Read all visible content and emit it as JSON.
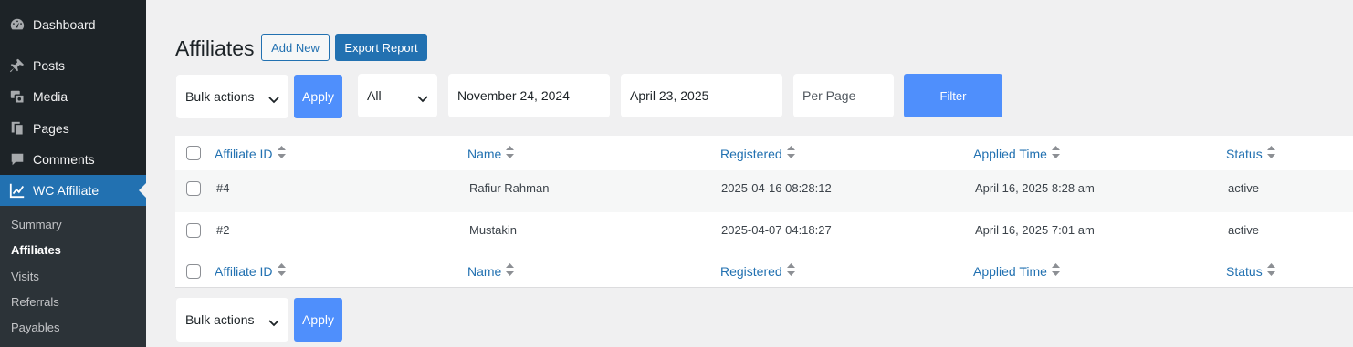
{
  "sidebar": {
    "menu": [
      {
        "label": "Dashboard",
        "icon": "dashboard-icon"
      },
      {
        "label": "Posts",
        "icon": "pushpin-icon"
      },
      {
        "label": "Media",
        "icon": "media-icon"
      },
      {
        "label": "Pages",
        "icon": "pages-icon"
      },
      {
        "label": "Comments",
        "icon": "comment-icon"
      },
      {
        "label": "WC Affiliate",
        "icon": "chart-line-icon",
        "active": true
      }
    ],
    "submenu": [
      {
        "label": "Summary"
      },
      {
        "label": "Affiliates",
        "current": true
      },
      {
        "label": "Visits"
      },
      {
        "label": "Referrals"
      },
      {
        "label": "Payables"
      }
    ]
  },
  "header": {
    "title": "Affiliates",
    "add_new_label": "Add New",
    "export_label": "Export Report"
  },
  "filters": {
    "bulk_actions": "Bulk actions",
    "apply_label": "Apply",
    "status_select": "All",
    "date_from": "November 24, 2024",
    "date_to": "April 23, 2025",
    "per_page_placeholder": "Per Page",
    "filter_label": "Filter"
  },
  "table": {
    "columns": [
      "Affiliate ID",
      "Name",
      "Registered",
      "Applied Time",
      "Status"
    ],
    "rows": [
      {
        "id": "#4",
        "name": "Rafiur Rahman",
        "registered": "2025-04-16 08:28:12",
        "applied": "April 16, 2025 8:28 am",
        "status": "active"
      },
      {
        "id": "#2",
        "name": "Mustakin",
        "registered": "2025-04-07 04:18:27",
        "applied": "April 16, 2025 7:01 am",
        "status": "active"
      }
    ]
  },
  "footer_actions": {
    "bulk_actions": "Bulk actions",
    "apply_label": "Apply"
  },
  "colors": {
    "sidebar_bg": "#1d2327",
    "active_menu": "#2271b1",
    "link_blue": "#2271b1",
    "button_blue": "#4f8ffc"
  }
}
